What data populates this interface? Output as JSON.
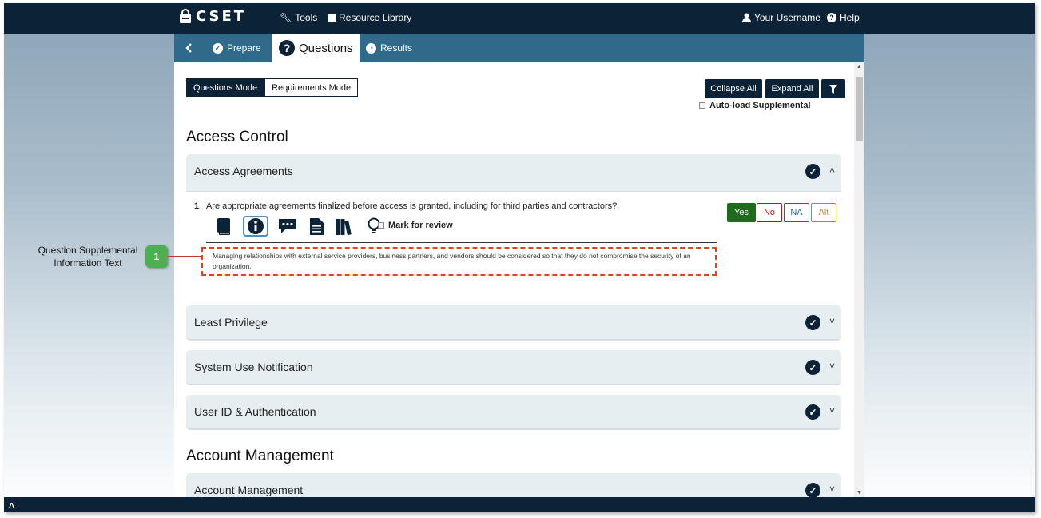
{
  "topbar": {
    "logo_text": "CSET",
    "tools": "Tools",
    "resource_library": "Resource Library",
    "username": "Your Username",
    "help": "Help"
  },
  "tabs": {
    "back_icon": "chevron-left-icon",
    "prepare": "Prepare",
    "questions": "Questions",
    "results": "Results"
  },
  "toolbar": {
    "questions_mode": "Questions Mode",
    "requirements_mode": "Requirements Mode",
    "collapse_all": "Collapse All",
    "expand_all": "Expand All",
    "filter_icon": "filter-icon",
    "auto_load": "Auto-load Supplemental"
  },
  "sections": [
    {
      "title": "Access Control",
      "groups": [
        {
          "title": "Access Agreements",
          "expanded": true,
          "question": {
            "number": "1",
            "text": "Are appropriate agreements finalized before access is granted, including for third parties and contractors?",
            "icons": [
              "book-icon",
              "info-icon",
              "comment-icon",
              "document-icon",
              "library-icon",
              "lightbulb-icon"
            ],
            "mark_for_review": "Mark for review",
            "supplemental": "Managing relationships with external service providers, business partners, and vendors should be considered so that they do not compromise the security of an organization.",
            "answers": [
              "Yes",
              "No",
              "NA",
              "Alt"
            ],
            "selected_answer": "Yes"
          }
        },
        {
          "title": "Least Privilege",
          "expanded": false
        },
        {
          "title": "System Use Notification",
          "expanded": false
        },
        {
          "title": "User ID & Authentication",
          "expanded": false
        }
      ]
    },
    {
      "title": "Account Management",
      "groups": [
        {
          "title": "Account Management",
          "expanded": false
        }
      ]
    }
  ],
  "callout": {
    "number": "1",
    "text": "Question Supplemental Information Text"
  },
  "colors": {
    "navy": "#0c2236",
    "tab_bar": "#2f6a8a",
    "yes": "#1e6b1e",
    "no": "#a51c1c",
    "na": "#2a5f88",
    "alt": "#c87f1a",
    "callout_green": "#4caf50",
    "highlight_border": "#e0451a"
  }
}
